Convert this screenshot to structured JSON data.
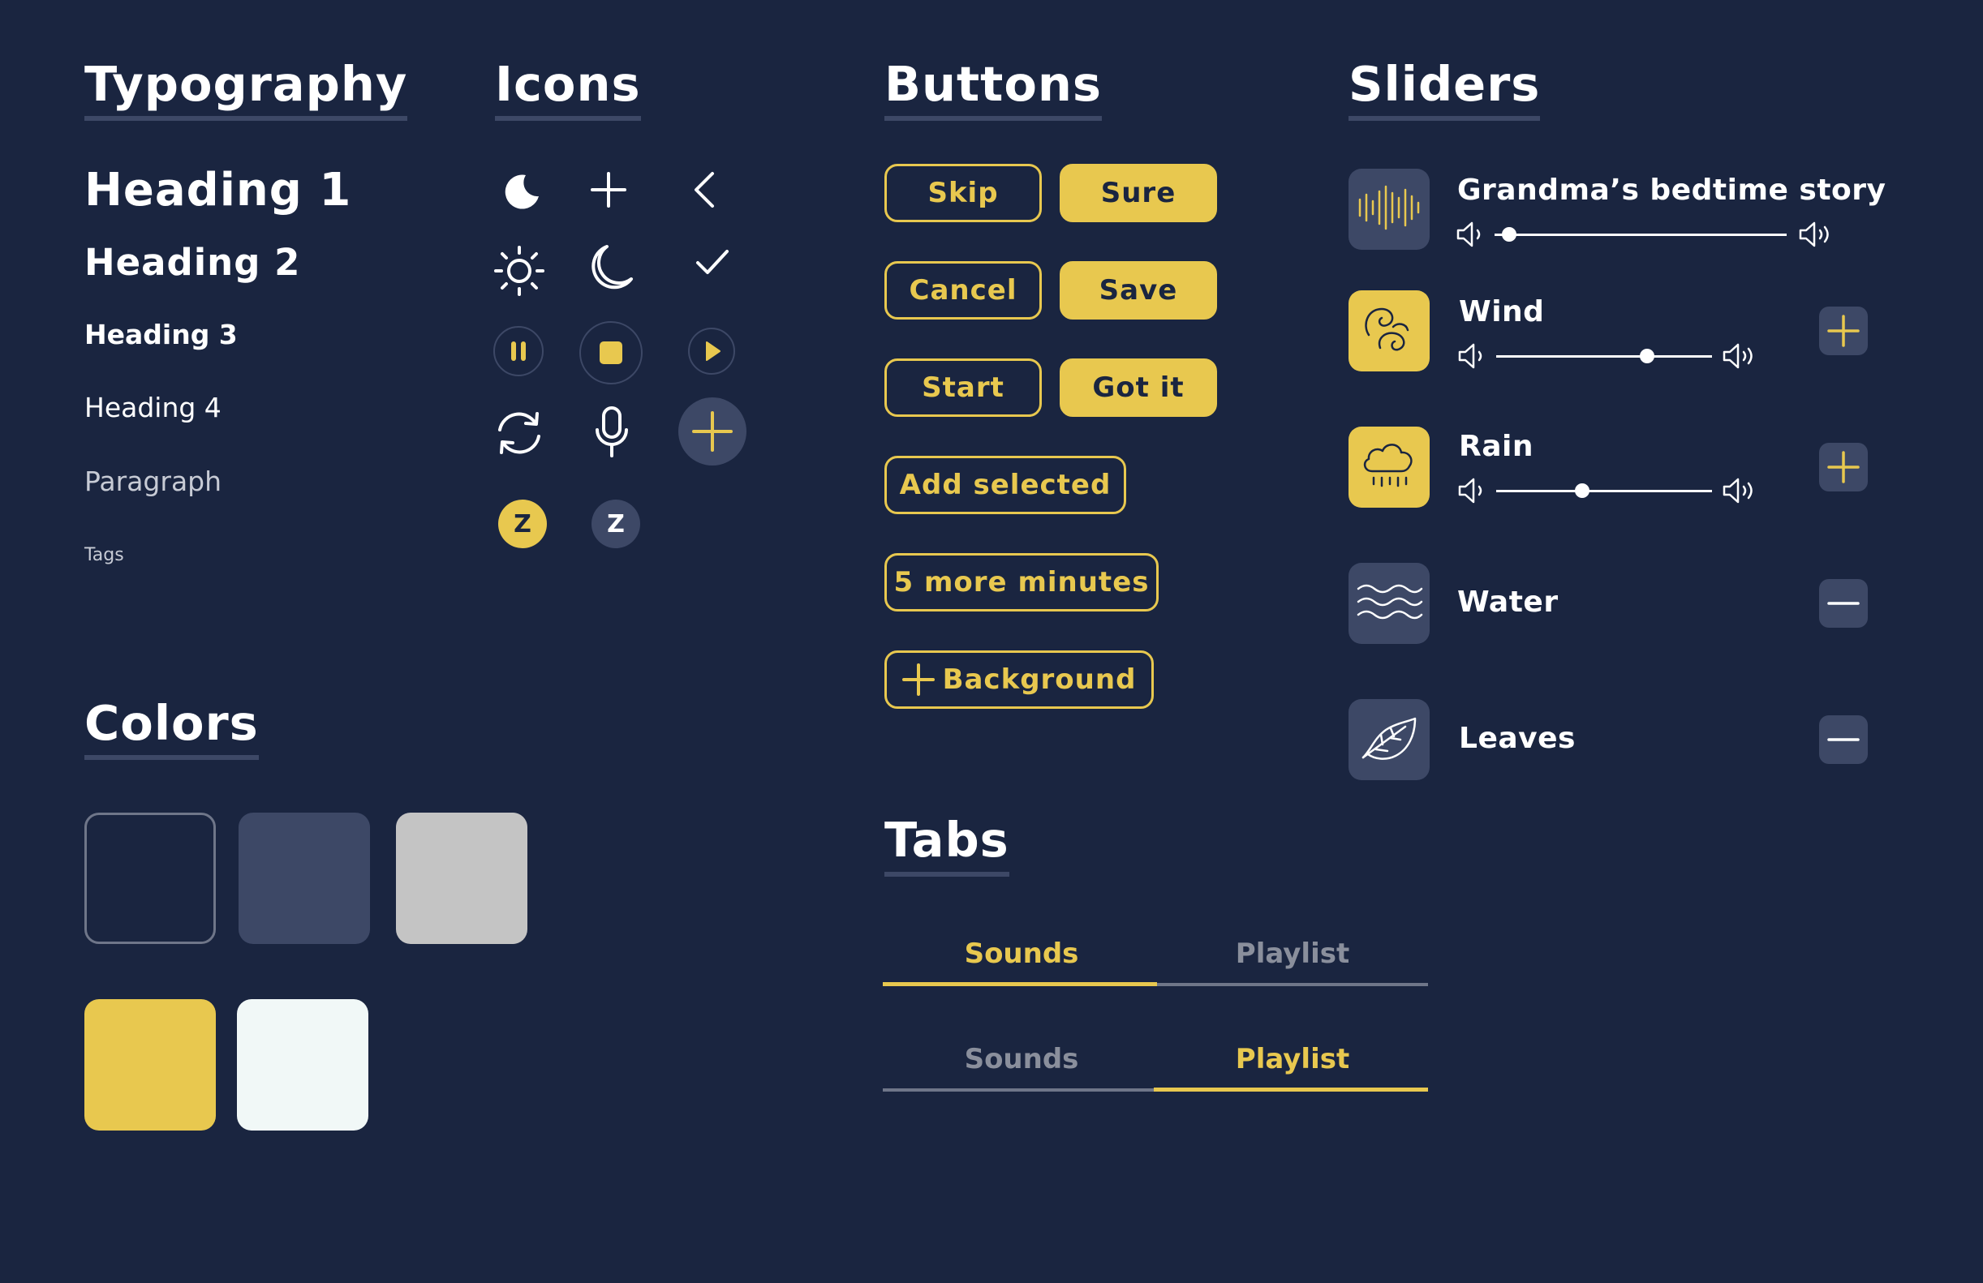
{
  "colors": {
    "background": "#1a2540",
    "surface": "#3d4866",
    "grey": "#c4c4c4",
    "accent": "#e8c84f",
    "white": "#f1f8f7",
    "muted": "#8a8f9c"
  },
  "sections": {
    "typography": "Typography",
    "icons": "Icons",
    "buttons": "Buttons",
    "sliders": "Sliders",
    "colors": "Colors",
    "tabs": "Tabs"
  },
  "typography": {
    "h1": "Heading 1",
    "h2": "Heading 2",
    "h3": "Heading 3",
    "h4": "Heading 4",
    "paragraph": "Paragraph",
    "tags": "Tags"
  },
  "icons": {
    "row1": [
      "moon-filled-icon",
      "plus-icon",
      "chevron-left-icon"
    ],
    "row2": [
      "sun-icon",
      "moon-outline-icon",
      "check-icon"
    ],
    "row3": [
      "pause-icon",
      "stop-icon",
      "play-icon"
    ],
    "row4": [
      "refresh-icon",
      "microphone-icon",
      "add-circle-icon"
    ],
    "row5_labels": [
      "Z",
      "Z"
    ]
  },
  "buttons": {
    "skip": "Skip",
    "sure": "Sure",
    "cancel": "Cancel",
    "save": "Save",
    "start": "Start",
    "got_it": "Got it",
    "add_selected": "Add selected",
    "five_more": "5 more minutes",
    "background": "Background"
  },
  "tabs": {
    "group1": {
      "items": [
        "Sounds",
        "Playlist"
      ],
      "active": 0
    },
    "group2": {
      "items": [
        "Sounds",
        "Playlist"
      ],
      "active": 1
    }
  },
  "sliders": {
    "items": [
      {
        "name": "Grandma’s bedtime story",
        "icon": "sound-wave-icon",
        "volume": 0.05,
        "active": false,
        "action": null
      },
      {
        "name": "Wind",
        "icon": "wind-icon",
        "volume": 0.7,
        "active": true,
        "action": "add"
      },
      {
        "name": "Rain",
        "icon": "rain-cloud-icon",
        "volume": 0.4,
        "active": true,
        "action": "add"
      },
      {
        "name": "Water",
        "icon": "waves-icon",
        "volume": null,
        "active": false,
        "action": "remove"
      },
      {
        "name": "Leaves",
        "icon": "leaf-icon",
        "volume": null,
        "active": false,
        "action": "remove"
      }
    ]
  }
}
